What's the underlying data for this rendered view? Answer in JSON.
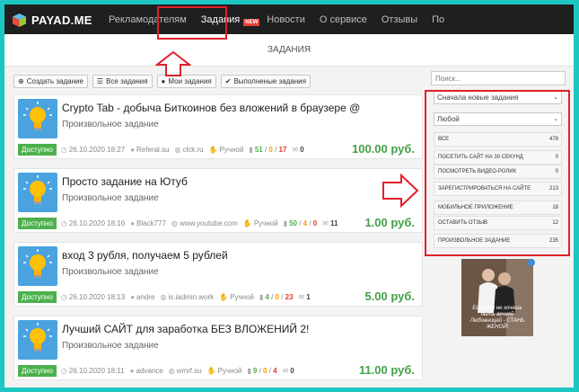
{
  "logo": {
    "text": "PAYAD.ME",
    "icon": "cube-logo-icon"
  },
  "nav": {
    "items": [
      "Рекламодателям",
      "Задания",
      "Новости",
      "О сервисе",
      "Отзывы",
      "По"
    ],
    "active_index": 1,
    "badge": "NEW"
  },
  "page": {
    "title": "ЗАДАНИЯ"
  },
  "toolbar": [
    {
      "icon": "plus-circle-icon",
      "label": "Создать задание"
    },
    {
      "icon": "list-icon",
      "label": "Все задания"
    },
    {
      "icon": "user-icon",
      "label": "Мои задания"
    },
    {
      "icon": "check-circle-icon",
      "label": "Выполненые задания"
    }
  ],
  "tasks": [
    {
      "title": "Crypto Tab - добыча Биткоинов без вложений в браузере @",
      "type": "Произвольное задание",
      "status": "Доступно",
      "date": "26.10.2020 18:27",
      "user": "Referal.su",
      "site": "clck.ru",
      "mode": "Ручной",
      "done": "51",
      "wait": "0",
      "rejected": "17",
      "msgs": "0",
      "price": "100.00 руб."
    },
    {
      "title": "Просто задание на Ютуб",
      "type": "Произвольное задание",
      "status": "Доступно",
      "date": "26.10.2020 18:16",
      "user": "Black777",
      "site": "www.youtube.com",
      "mode": "Ручной",
      "done": "50",
      "wait": "4",
      "rejected": "0",
      "msgs": "11",
      "price": "1.00 руб."
    },
    {
      "title": "вход 3 рубля, получаем 5 рублей",
      "type": "Произвольное задание",
      "status": "Доступно",
      "date": "26.10.2020 18:13",
      "user": "andre",
      "site": "is.iadmin.work",
      "mode": "Ручной",
      "done": "4",
      "wait": "0",
      "rejected": "23",
      "msgs": "1",
      "price": "5.00 руб."
    },
    {
      "title": "Лучший САЙТ для заработка БЕЗ ВЛОЖЕНИЙ 2!",
      "type": "Произвольное задание",
      "status": "Доступно",
      "date": "26.10.2020 18:11",
      "user": "advance",
      "site": "wmrf.su",
      "mode": "Ручной",
      "done": "9",
      "wait": "0",
      "rejected": "4",
      "msgs": "0",
      "price": "11.00 руб."
    }
  ],
  "sidebar": {
    "search_placeholder": "Поиск...",
    "sort": "Сначала новые задания",
    "type": "Любой",
    "filters": [
      {
        "label": "Все",
        "count": "478"
      },
      {
        "label": "Посетить сайт на 30 секунд",
        "count": "0"
      },
      {
        "label": "Посмотреть видео-ролик",
        "count": "0"
      },
      {
        "label": "Зарегистрироваться на сайте",
        "count": "213"
      },
      {
        "label": "Мобильное приложение",
        "count": "18"
      },
      {
        "label": "Оставить отзыв",
        "count": "12"
      },
      {
        "label": "Произвольное задание",
        "count": "235"
      }
    ],
    "ad_text": "Если ты не хочешь быть вечной Любовницей - СТАНЬ ЖЕНОЙ!"
  },
  "colors": {
    "highlight": "#e0202a",
    "accent_green": "#43a047",
    "topbar": "#1f1f1f",
    "bulb_bg": "#4aa3df",
    "frame": "#1cc7c1"
  }
}
